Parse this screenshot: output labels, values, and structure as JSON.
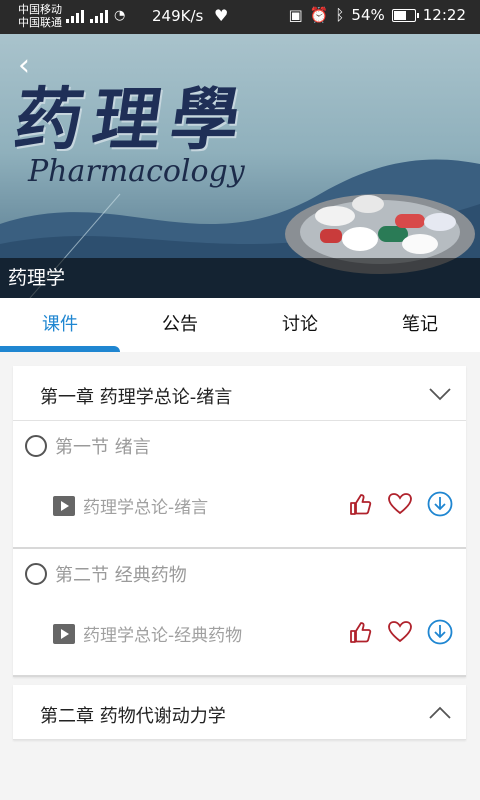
{
  "status": {
    "carrier1": "中国移动",
    "carrier2": "中国联通",
    "network_speed": "249K/s",
    "battery": "54%",
    "time": "12:22",
    "battery_level": 0.54
  },
  "banner": {
    "image_chars": "药理學",
    "image_subtitle": "Pharmacology",
    "title": "药理学"
  },
  "tabs": [
    {
      "label": "课件"
    },
    {
      "label": "公告"
    },
    {
      "label": "讨论"
    },
    {
      "label": "笔记"
    }
  ],
  "chapters": [
    {
      "title": "第一章 药理学总论-绪言",
      "expanded": true,
      "sections": [
        {
          "title": "第一节 绪言",
          "video": "药理学总论-绪言"
        },
        {
          "title": "第二节 经典药物",
          "video": "药理学总论-经典药物"
        }
      ]
    },
    {
      "title": "第二章  药物代谢动力学",
      "expanded": false
    }
  ],
  "colors": {
    "accent": "#1f86d1",
    "like_heart": "#b0222c"
  }
}
